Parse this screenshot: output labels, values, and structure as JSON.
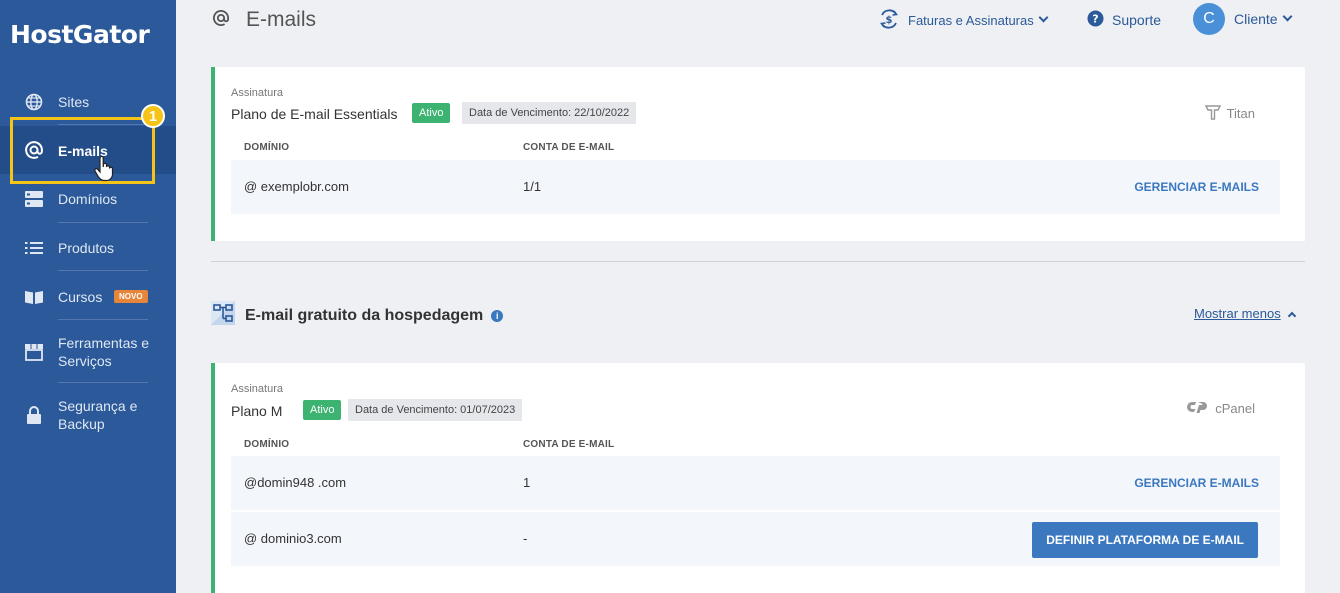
{
  "sidebar": {
    "brand": "HostGator",
    "items": [
      {
        "label": "Sites",
        "icon": "globe-icon"
      },
      {
        "label": "E-mails",
        "icon": "at-icon"
      },
      {
        "label": "Domínios",
        "icon": "server-icon"
      },
      {
        "label": "Produtos",
        "icon": "list-icon"
      },
      {
        "label": "Cursos",
        "icon": "book-icon",
        "badge": "NOVO"
      },
      {
        "label": "Ferramentas e Serviços",
        "icon": "store-icon"
      },
      {
        "label": "Segurança e Backup",
        "icon": "lock-icon"
      }
    ],
    "step_number": "1"
  },
  "header": {
    "title": "E-mails",
    "billing_label": "Faturas e Assinaturas",
    "support_label": "Suporte",
    "user_initial": "C",
    "user_label": "Cliente"
  },
  "subscription": {
    "label": "Assinatura",
    "plan_name": "Plano de E-mail Essentials",
    "status": "Ativo",
    "due": "Data de Vencimento: 22/10/2022",
    "provider": "Titan",
    "col_domain": "DOMÍNIO",
    "col_account": "CONTA DE E-MAIL",
    "rows": [
      {
        "domain": "@ exemplobr.com",
        "count": "1/1",
        "action": "GERENCIAR E-MAILS"
      }
    ]
  },
  "free_section": {
    "title": "E-mail gratuito da hospedagem",
    "info": "i",
    "toggle_label": "Mostrar menos"
  },
  "hosting": {
    "label": "Assinatura",
    "plan_name": "Plano M",
    "status": "Ativo",
    "due": "Data de Vencimento: 01/07/2023",
    "provider": "cPanel",
    "col_domain": "DOMÍNIO",
    "col_account": "CONTA DE E-MAIL",
    "rows": [
      {
        "domain": "@domin948 .com",
        "count": "1",
        "action": "GERENCIAR E-MAILS"
      },
      {
        "domain": "@ dominio3.com",
        "count": "-",
        "action": "DEFINIR PLATAFORMA DE E-MAIL"
      }
    ]
  },
  "colors": {
    "sidebar": "#2b5999",
    "accent": "#3b78c0",
    "active_green": "#3cb371",
    "highlight": "#f5c416"
  }
}
